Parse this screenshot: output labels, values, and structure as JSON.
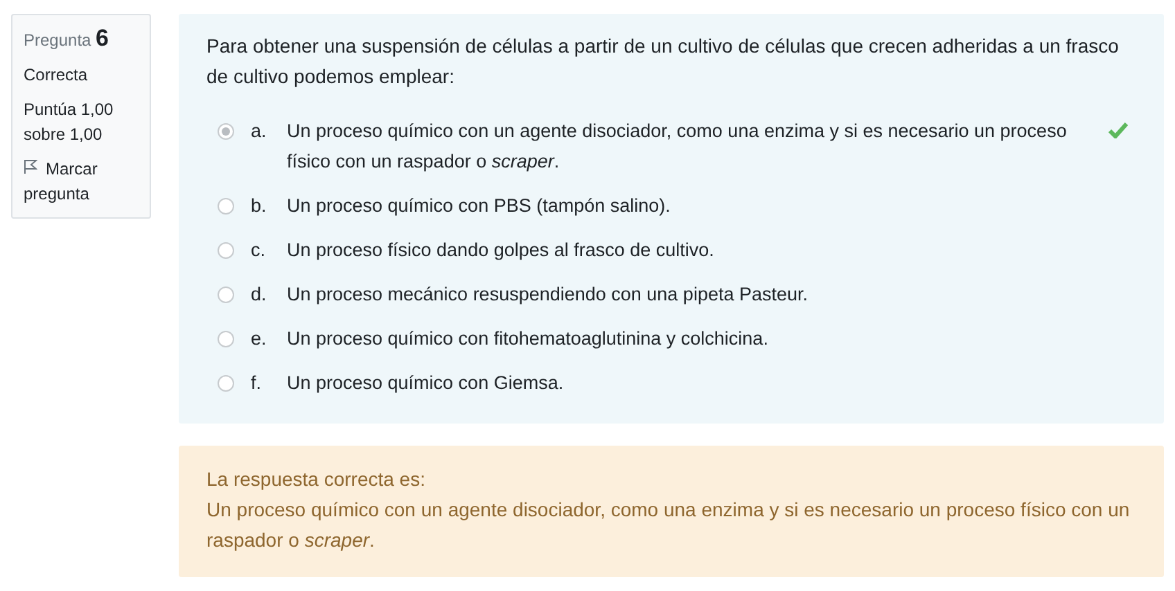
{
  "info": {
    "label": "Pregunta",
    "number": "6",
    "status": "Correcta",
    "score": "Puntúa 1,00 sobre 1,00",
    "flag": "Marcar pregunta"
  },
  "question": {
    "text": "Para obtener una suspensión de células a partir de un cultivo de células que crecen adheridas a un frasco de cultivo podemos emplear:",
    "options": [
      {
        "letter": "a.",
        "text": "Un proceso químico con un agente disociador, como una enzima y si es necesario un proceso físico con un raspador o *scraper*.",
        "selected": true,
        "correct": true
      },
      {
        "letter": "b.",
        "text": "Un proceso químico con PBS (tampón salino).",
        "selected": false,
        "correct": false
      },
      {
        "letter": "c.",
        "text": "Un proceso físico dando golpes al frasco de cultivo.",
        "selected": false,
        "correct": false
      },
      {
        "letter": "d.",
        "text": "Un proceso mecánico resuspendiendo con una pipeta Pasteur.",
        "selected": false,
        "correct": false
      },
      {
        "letter": "e.",
        "text": "Un proceso químico con fitohematoaglutinina y colchicina.",
        "selected": false,
        "correct": false
      },
      {
        "letter": "f.",
        "text": "Un proceso químico con Giemsa.",
        "selected": false,
        "correct": false
      }
    ]
  },
  "feedback": {
    "heading": "La respuesta correcta es:",
    "answer": "Un proceso químico con un agente disociador, como una enzima y si es necesario un proceso físico con un raspador o *scraper*."
  }
}
